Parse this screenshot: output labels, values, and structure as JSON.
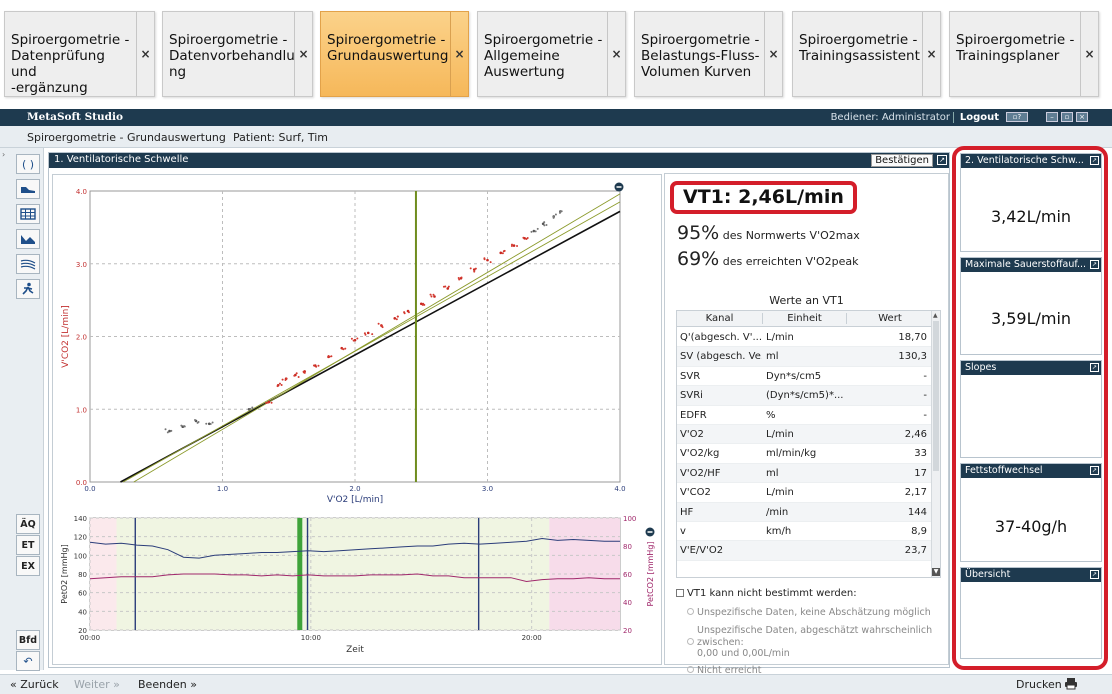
{
  "workflow_tabs": [
    {
      "label": "Spiroergometrie -\nDatenprüfung und\n-ergänzung",
      "active": false
    },
    {
      "label": "Spiroergometrie -\nDatenvorbehandlu\nng",
      "active": false
    },
    {
      "label": "Spiroergometrie -\nGrundauswertung",
      "active": true
    },
    {
      "label": "Spiroergometrie -\nAllgemeine\nAuswertung",
      "active": false
    },
    {
      "label": "Spiroergometrie -\nBelastungs-Fluss-\nVolumen Kurven",
      "active": false
    },
    {
      "label": "Spiroergometrie -\nTrainingsassistent",
      "active": false
    },
    {
      "label": "Spiroergometrie -\nTrainingsplaner",
      "active": false
    }
  ],
  "close_glyph": "×",
  "app": {
    "title": "MetaSoft Studio",
    "operator": "Bediener: Administrator",
    "logout": "Logout"
  },
  "subheader": {
    "title": "Spiroergometrie - Grundauswertung",
    "patient": "Patient:  Surf, Tim"
  },
  "left_toolbar": {
    "icons": [
      "parentheses-icon",
      "shoe-icon",
      "table-icon",
      "chart-icon",
      "waves-icon",
      "runner-icon"
    ],
    "text_buttons": [
      "ÄQ",
      "ET",
      "EX"
    ],
    "bottom_buttons": [
      "Bfd"
    ]
  },
  "panel": {
    "title": "1. Ventilatorische Schwelle",
    "confirm": "Bestätigen"
  },
  "chart_data": [
    {
      "type": "scatter",
      "xlabel": "V'O2 [L/min]",
      "ylabel": "V'CO2 [L/min]",
      "xlim": [
        0,
        4
      ],
      "ylim": [
        0,
        4
      ],
      "xticks": [
        "0.0",
        "1.0",
        "2.0",
        "3.0",
        "4.0"
      ],
      "yticks": [
        "0.0",
        "1.0",
        "2.0",
        "3.0",
        "4.0"
      ],
      "grid": true,
      "vt1_marker_x": 2.46,
      "fit_lines": [
        {
          "name": "fit",
          "x": [
            0.23,
            4.0
          ],
          "y": [
            0.0,
            3.72
          ]
        },
        {
          "name": "slope-a",
          "x": [
            0.33,
            4.0
          ],
          "y": [
            0.0,
            3.96
          ]
        },
        {
          "name": "slope-b",
          "x": [
            0.25,
            4.0
          ],
          "y": [
            0.0,
            3.85
          ]
        }
      ],
      "points": [
        [
          0.6,
          0.7
        ],
        [
          0.7,
          0.76
        ],
        [
          0.8,
          0.84
        ],
        [
          0.9,
          0.8
        ],
        [
          1.2,
          1.0
        ],
        [
          1.35,
          1.1
        ],
        [
          1.42,
          1.33
        ],
        [
          1.48,
          1.42
        ],
        [
          1.55,
          1.47
        ],
        [
          1.62,
          1.52
        ],
        [
          1.7,
          1.6
        ],
        [
          1.8,
          1.72
        ],
        [
          1.9,
          1.84
        ],
        [
          2.0,
          1.95
        ],
        [
          2.1,
          2.05
        ],
        [
          2.2,
          2.15
        ],
        [
          2.3,
          2.25
        ],
        [
          2.4,
          2.35
        ],
        [
          2.5,
          2.45
        ],
        [
          2.6,
          2.55
        ],
        [
          2.7,
          2.66
        ],
        [
          2.8,
          2.8
        ],
        [
          2.9,
          2.92
        ],
        [
          3.0,
          3.05
        ],
        [
          3.1,
          3.15
        ],
        [
          3.2,
          3.25
        ],
        [
          3.28,
          3.35
        ],
        [
          3.35,
          3.45
        ],
        [
          3.42,
          3.55
        ],
        [
          3.5,
          3.65
        ],
        [
          3.55,
          3.72
        ]
      ]
    },
    {
      "type": "line",
      "xlabel": "Zeit",
      "ylabel_left": "PetO2 [mmHg]",
      "ylabel_right": "PetCO2 [mmHg]",
      "xlim": [
        0,
        24
      ],
      "ylim_left": [
        20,
        140
      ],
      "ylim_right": [
        20,
        100
      ],
      "xticks": [
        "00:00",
        "10:00",
        "20:00"
      ],
      "yticks_left": [
        "20",
        "40",
        "60",
        "80",
        "100",
        "120",
        "140"
      ],
      "yticks_right": [
        "20",
        "40",
        "60",
        "80",
        "100"
      ],
      "markers_x": [
        2.05,
        9.85,
        17.6
      ],
      "vt1_time": 9.5,
      "phases": [
        {
          "from": 0,
          "to": 1.2,
          "color": "#fbe9ec"
        },
        {
          "from": 1.2,
          "to": 20.8,
          "color": "#f0f5e2"
        },
        {
          "from": 20.8,
          "to": 24,
          "color": "#f7dcea"
        }
      ],
      "series": [
        {
          "color": "#2b3d7a",
          "values": [
            114,
            112,
            113,
            111,
            110,
            106,
            98,
            97,
            100,
            101,
            102,
            103,
            103,
            104,
            105,
            104,
            105,
            106,
            107,
            108,
            109,
            110,
            110,
            112,
            113,
            112,
            113,
            114,
            115,
            118,
            116,
            117,
            116,
            115,
            115
          ]
        },
        {
          "color": "#a0286b",
          "values": [
            75,
            76,
            77,
            77,
            77,
            79,
            80,
            80,
            80,
            79,
            79,
            78,
            79,
            78,
            79,
            78,
            78,
            78,
            79,
            79,
            79,
            80,
            78,
            78,
            76,
            76,
            76,
            76,
            72,
            74,
            75,
            75,
            76,
            75,
            75
          ]
        }
      ]
    }
  ],
  "vt1": {
    "headline": "VT1: 2,46L/min",
    "pct1_value": "95%",
    "pct1_text": " des Normwerts V'O2max",
    "pct2_value": "69%",
    "pct2_text": " des erreichten V'O2peak",
    "table_title": "Werte an VT1",
    "table_headers": [
      "Kanal",
      "Einheit",
      "Wert"
    ],
    "rows": [
      [
        "Q'(abgesch. V'...",
        "L/min",
        "18,70"
      ],
      [
        "SV (abgesch. Ve...",
        "ml",
        "130,3"
      ],
      [
        "SVR",
        "Dyn*s/cm5",
        "-"
      ],
      [
        "SVRi",
        "(Dyn*s/cm5)*...",
        "-"
      ],
      [
        "EDFR",
        "%",
        "-"
      ],
      [
        "V'O2",
        "L/min",
        "2,46"
      ],
      [
        "V'O2/kg",
        "ml/min/kg",
        "33"
      ],
      [
        "V'O2/HF",
        "ml",
        "17"
      ],
      [
        "V'CO2",
        "L/min",
        "2,17"
      ],
      [
        "HF",
        "/min",
        "144"
      ],
      [
        "v",
        "km/h",
        "8,9"
      ],
      [
        "V'E/V'O2",
        "",
        "23,7"
      ]
    ],
    "checkbox": "VT1 kann nicht bestimmt werden:",
    "radio1": "Unspezifische Daten, keine Abschätzung möglich",
    "radio2a": "Unspezifische Daten, abgeschätzt wahrscheinlich",
    "radio2b": "zwischen:",
    "radio2c": "0,00 und 0,00L/min",
    "radio3": "Nicht erreicht"
  },
  "right_panels": [
    {
      "title": "2. Ventilatorische Schw...",
      "value": "3,42L/min"
    },
    {
      "title": "Maximale Sauerstoffauf...",
      "value": "3,59L/min"
    },
    {
      "title": "Slopes",
      "value": ""
    },
    {
      "title": "Fettstoffwechsel",
      "value": "37-40g/h"
    },
    {
      "title": "Übersicht",
      "value": ""
    }
  ],
  "bottom": {
    "back": "« Zurück",
    "next": "Weiter »",
    "end": "Beenden »",
    "print": "Drucken"
  },
  "colors": {
    "header": "#1e3a4f",
    "highlight": "#d41e2a",
    "active_tab": "#f6b85a",
    "grid": "#bdbdbd"
  }
}
